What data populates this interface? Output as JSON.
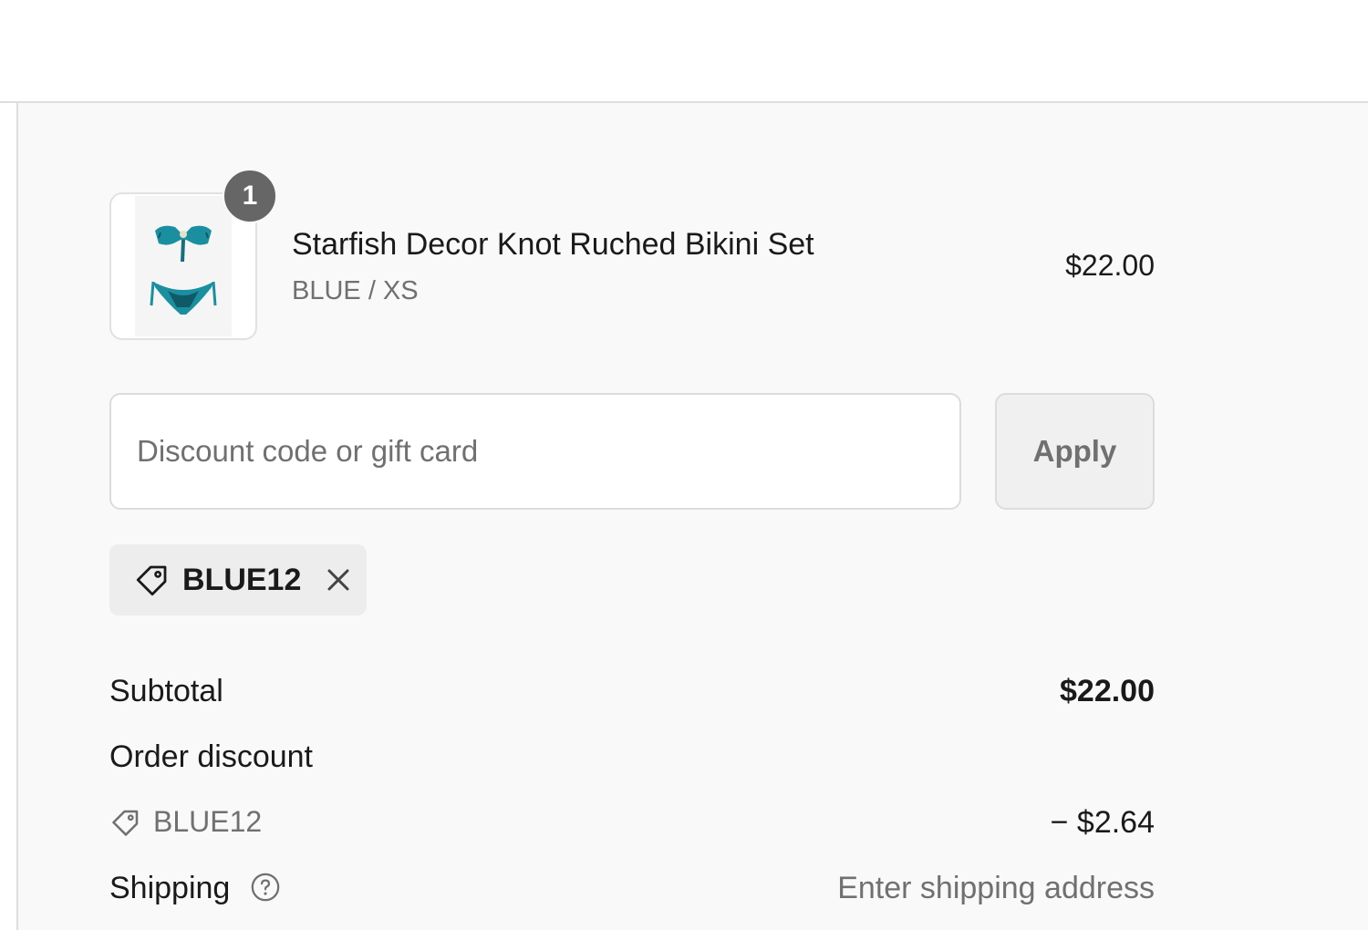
{
  "order_summary": {
    "line_item": {
      "quantity": "1",
      "name": "Starfish Decor Knot Ruched Bikini Set",
      "variant": "BLUE / XS",
      "price": "$22.00",
      "image_icon": "bikini-product-image",
      "image_color": "#1a8fa0"
    },
    "discount": {
      "placeholder": "Discount code or gift card",
      "value": "",
      "apply_label": "Apply"
    },
    "applied_code": {
      "code": "BLUE12",
      "tag_icon": "tag-icon",
      "remove_icon": "close-icon"
    },
    "totals": {
      "subtotal_label": "Subtotal",
      "subtotal_value": "$22.00",
      "order_discount_label": "Order discount",
      "discount_code": "BLUE12",
      "discount_amount": "− $2.64",
      "shipping_label": "Shipping",
      "shipping_value": "Enter shipping address",
      "help_icon": "question-circle-icon"
    }
  }
}
